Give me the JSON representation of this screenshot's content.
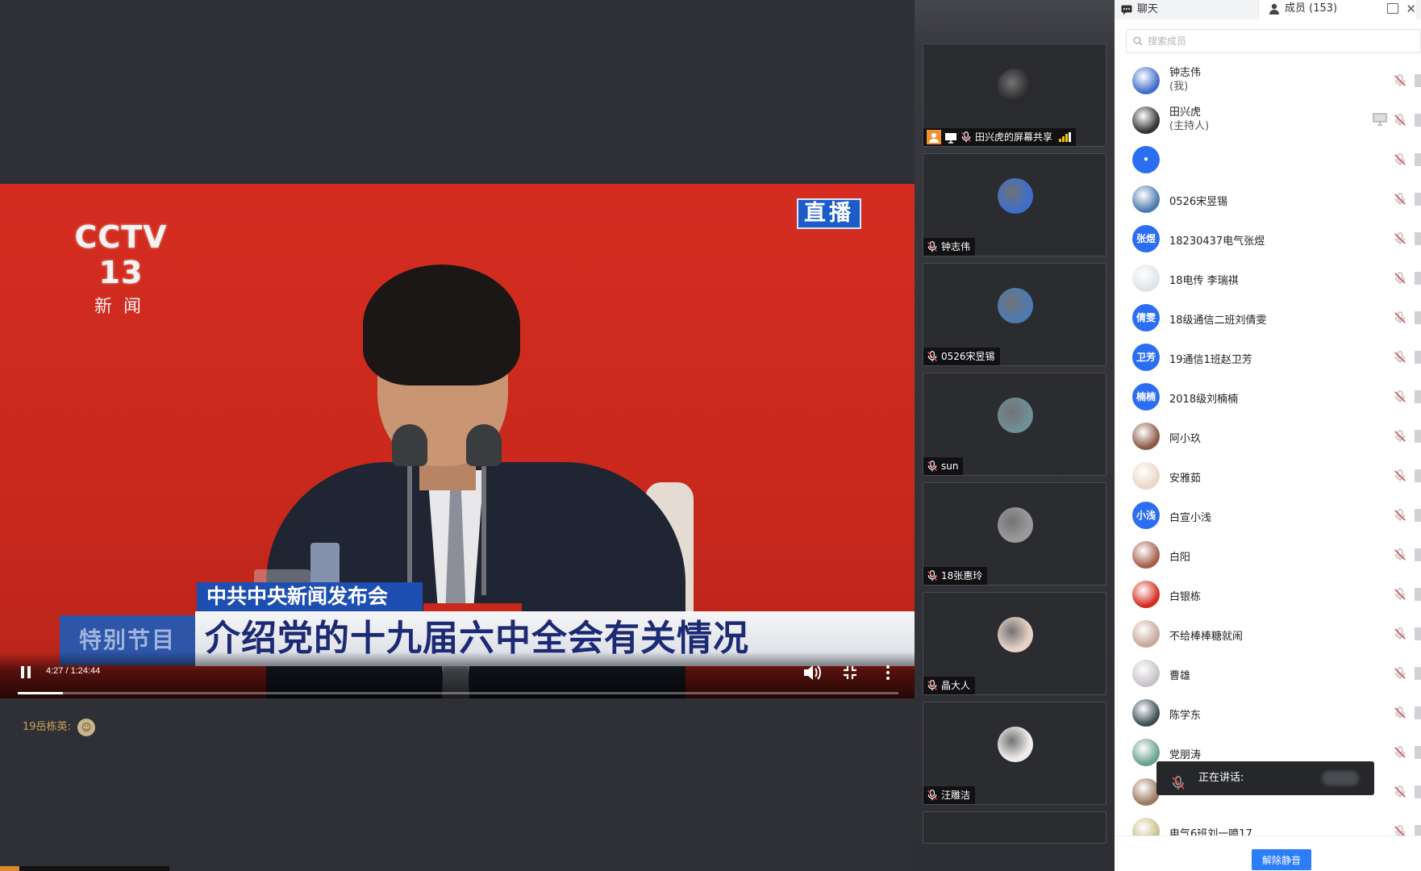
{
  "player": {
    "channel_logo": "CCTV 13",
    "channel_sub": "新闻",
    "live_badge": "直播",
    "caption_small": "中共中央新闻发布会",
    "caption_tag": "特别节目",
    "caption_big": "介绍党的十九届六中全会有关情况",
    "time": "4:27 / 1:24:44",
    "progress_fraction": 0.051
  },
  "chat_line": {
    "sender": "19岳栋英:",
    "emoji": "emoji-sticker"
  },
  "tiles": [
    {
      "name": "田兴虎的屏幕共享",
      "avatar_color": "#2a2a2a",
      "sharing": true
    },
    {
      "name": "钟志伟",
      "avatar_color": "#3f6ec8"
    },
    {
      "name": "0526宋昱锡",
      "avatar_color": "#4d7bb0"
    },
    {
      "name": "sun",
      "avatar_color": "#6f8e96"
    },
    {
      "name": "18张惠玲",
      "avatar_color": "#9a9a9a"
    },
    {
      "name": "晶大人",
      "avatar_color": "#e8d2c4"
    },
    {
      "name": "汪雕洁",
      "avatar_color": "#f0ece8"
    }
  ],
  "panel": {
    "tab_chat": "聊天",
    "tab_members": "成员 (153)",
    "search_placeholder": "搜索成员",
    "members": [
      {
        "name": "钟志伟",
        "sub": "(我)",
        "avatar_text": "",
        "color": "#3f6ec8"
      },
      {
        "name": "田兴虎",
        "sub": "(主持人)",
        "avatar_text": "",
        "color": "#333333",
        "screen": true
      },
      {
        "name": "",
        "avatar_text": "•",
        "color": "#2c6ef2"
      },
      {
        "name": "0526宋昱锡",
        "avatar_text": "",
        "color": "#4d7bb0"
      },
      {
        "name": "18230437电气张煜",
        "avatar_text": "张煜",
        "color": "#2c6ef2"
      },
      {
        "name": "18电传 李瑞祺",
        "avatar_text": "",
        "color": "#dfe4ea"
      },
      {
        "name": "18级通信二班刘倩雯",
        "avatar_text": "倩雯",
        "color": "#2c6ef2"
      },
      {
        "name": "19通信1班赵卫芳",
        "avatar_text": "卫芳",
        "color": "#2c6ef2"
      },
      {
        "name": "2018级刘楠楠",
        "avatar_text": "楠楠",
        "color": "#2c6ef2"
      },
      {
        "name": "阿小玖",
        "avatar_text": "",
        "color": "#8a5a44"
      },
      {
        "name": "安雅茹",
        "avatar_text": "",
        "color": "#e9d8c6"
      },
      {
        "name": "白宣小浅",
        "avatar_text": "小浅",
        "color": "#2c6ef2"
      },
      {
        "name": "白阳",
        "avatar_text": "",
        "color": "#a55d4a"
      },
      {
        "name": "白银栋",
        "avatar_text": "",
        "color": "#d42b1e"
      },
      {
        "name": "不给棒棒糖就闹",
        "avatar_text": "",
        "color": "#c9a89a"
      },
      {
        "name": "曹雄",
        "avatar_text": "",
        "color": "#c7c2c8"
      },
      {
        "name": "陈学东",
        "avatar_text": "",
        "color": "#3d4e55"
      },
      {
        "name": "党朋涛",
        "avatar_text": "",
        "color": "#6aa08e"
      },
      {
        "name": "",
        "avatar_text": "",
        "color": "#9b7760"
      },
      {
        "name": "电气6班刘一噫17",
        "avatar_text": "",
        "color": "#c9c08a"
      }
    ],
    "speaking_label": "正在讲话:",
    "unmute_all": "解除静音"
  },
  "colors": {
    "accent": "#2c7ef8",
    "dark_bg": "#2f3035",
    "studio_red": "#c9281c"
  }
}
